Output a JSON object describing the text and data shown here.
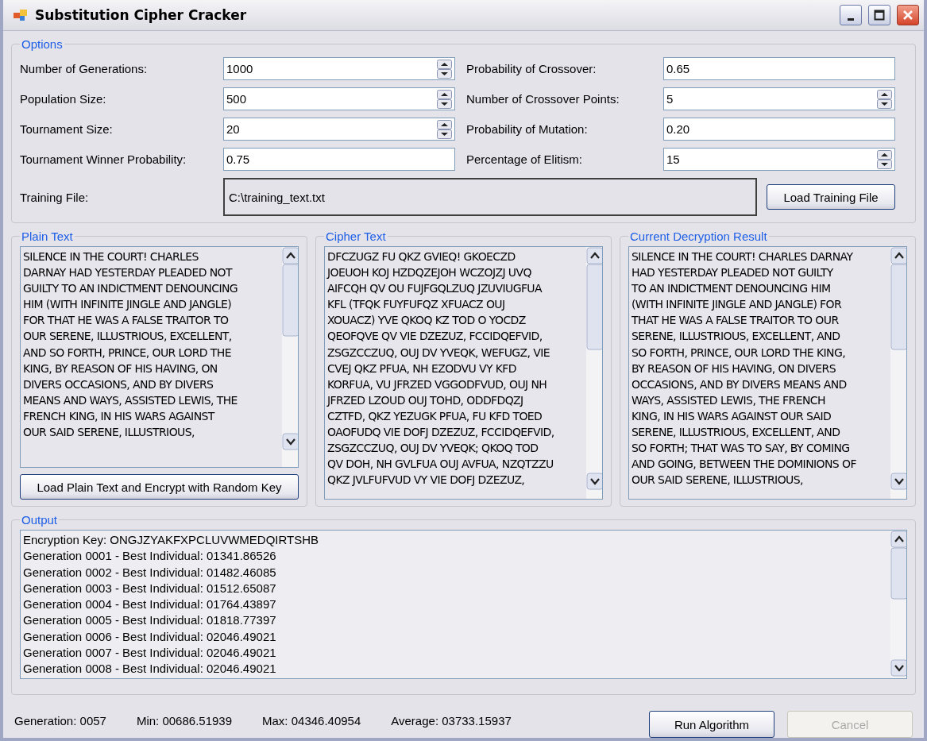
{
  "window": {
    "title": "Substitution Cipher Cracker"
  },
  "options": {
    "title": "Options",
    "left": [
      {
        "label": "Number of Generations:",
        "value": "1000",
        "kind": "spin"
      },
      {
        "label": "Population Size:",
        "value": "500",
        "kind": "spin"
      },
      {
        "label": "Tournament Size:",
        "value": "20",
        "kind": "spin"
      },
      {
        "label": "Tournament Winner Probability:",
        "value": "0.75",
        "kind": "text"
      }
    ],
    "right": [
      {
        "label": "Probability of Crossover:",
        "value": "0.65",
        "kind": "text"
      },
      {
        "label": "Number of Crossover Points:",
        "value": "5",
        "kind": "spin"
      },
      {
        "label": "Probability of Mutation:",
        "value": "0.20",
        "kind": "text"
      },
      {
        "label": "Percentage of Elitism:",
        "value": "15",
        "kind": "spin"
      }
    ],
    "training_file": {
      "label": "Training File:",
      "value": "C:\\training_text.txt",
      "button": "Load Training File"
    }
  },
  "panels": [
    {
      "title": "Plain Text",
      "lines": [
        "SILENCE IN THE COURT! CHARLES",
        "DARNAY HAD YESTERDAY PLEADED NOT",
        "GUILTY TO AN INDICTMENT DENOUNCING",
        "HIM (WITH INFINITE JINGLE AND JANGLE)",
        "FOR THAT HE WAS A FALSE TRAITOR TO",
        "OUR SERENE, ILLUSTRIOUS, EXCELLENT,",
        "AND SO FORTH, PRINCE, OUR LORD THE",
        "KING, BY REASON OF HIS HAVING, ON",
        "DIVERS OCCASIONS, AND BY DIVERS",
        "MEANS AND WAYS, ASSISTED LEWIS, THE",
        "FRENCH KING, IN HIS WARS AGAINST",
        "OUR SAID SERENE, ILLUSTRIOUS,"
      ],
      "button": "Load Plain Text and Encrypt with Random Key"
    },
    {
      "title": "Cipher Text",
      "lines": [
        "DFCZUGZ FU QKZ GVIEQ! GKOECZD",
        "JOEUOH KOJ HZDQZEJOH WCZOJZJ UVQ",
        "AIFCQH QV OU FUJFGQLZUQ JZUVIUGFUA",
        "KFL (TFQK FUYFUFQZ XFUACZ OUJ",
        "XOUACZ) YVE QKOQ KZ TOD O YOCDZ",
        "QEOFQVE QV VIE DZEZUZ, FCCIDQEFVID,",
        "ZSGZCCZUQ, OUJ DV YVEQK, WEFUGZ, VIE",
        "CVEJ QKZ PFUA, NH EZODVU VY KFD",
        "KORFUA, VU JFRZED VGGODFVUD, OUJ NH",
        "JFRZED LZOUD OUJ TOHD, ODDFDQZJ",
        "CZTFD, QKZ YEZUGK PFUA, FU KFD TOED",
        "OAOFUDQ VIE DOFJ DZEZUZ, FCCIDQEFVID,",
        "ZSGZCCZUQ, OUJ DV YVEQK; QKOQ TOD",
        "QV DOH, NH GVLFUA OUJ AVFUA, NZQTZZU",
        "QKZ JVLFUFVUD VY VIE DOFJ DZEZUZ,"
      ]
    },
    {
      "title": "Current Decryption Result",
      "lines": [
        "SILENCE IN THE COURT! CHARLES DARNAY",
        "HAD YESTERDAY PLEADED NOT GUILTY",
        "TO AN INDICTMENT DENOUNCING HIM",
        "(WITH INFINITE JINGLE AND JANGLE) FOR",
        "THAT HE WAS A FALSE TRAITOR TO OUR",
        "SERENE, ILLUSTRIOUS, EXCELLENT, AND",
        "SO FORTH, PRINCE, OUR LORD THE KING,",
        "BY REASON OF HIS HAVING, ON DIVERS",
        "OCCASIONS, AND BY DIVERS MEANS AND",
        "WAYS, ASSISTED LEWIS, THE FRENCH",
        "KING, IN HIS WARS AGAINST OUR SAID",
        "SERENE, ILLUSTRIOUS, EXCELLENT, AND",
        "SO FORTH; THAT WAS TO SAY, BY COMING",
        "AND GOING, BETWEEN THE DOMINIONS OF",
        "OUR SAID SERENE, ILLUSTRIOUS,"
      ]
    }
  ],
  "output": {
    "title": "Output",
    "lines": [
      "Encryption Key: ONGJZYAKFXPCLUVWMEDQIRTSHB",
      "Generation 0001 - Best Individual: 01341.86526",
      "Generation 0002 - Best Individual: 01482.46085",
      "Generation 0003 - Best Individual: 01512.65087",
      "Generation 0004 - Best Individual: 01764.43897",
      "Generation 0005 - Best Individual: 01818.77397",
      "Generation 0006 - Best Individual: 02046.49021",
      "Generation 0007 - Best Individual: 02046.49021",
      "Generation 0008 - Best Individual: 02046.49021"
    ]
  },
  "status": [
    "Generation: 0057",
    "Min: 00686.51939",
    "Max: 04346.40954",
    "Average: 03733.15937"
  ],
  "buttons": [
    {
      "label": "Run Algorithm",
      "disabled": false
    },
    {
      "label": "Cancel",
      "disabled": true
    }
  ]
}
